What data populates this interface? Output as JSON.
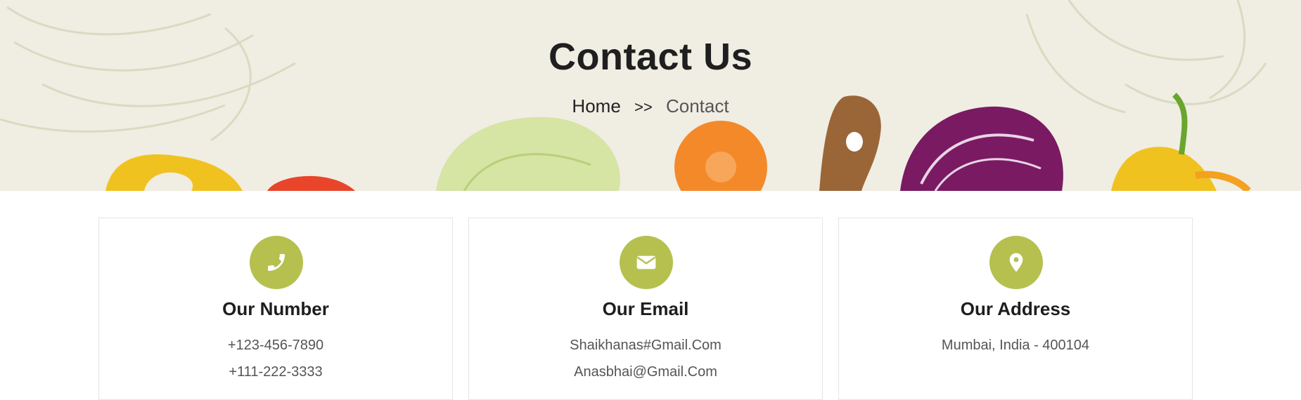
{
  "hero": {
    "title": "Contact Us",
    "breadcrumb": {
      "home": "Home",
      "separator": ">>",
      "current": "Contact"
    }
  },
  "cards": [
    {
      "title": "Our Number",
      "icon": "phone-icon",
      "lines": [
        "+123-456-7890",
        "+111-222-3333"
      ]
    },
    {
      "title": "Our Email",
      "icon": "envelope-icon",
      "lines": [
        "Shaikhanas#Gmail.Com",
        "Anasbhai@Gmail.Com"
      ]
    },
    {
      "title": "Our Address",
      "icon": "map-pin-icon",
      "lines": [
        "Mumbai, India - 400104"
      ]
    }
  ],
  "colors": {
    "accent": "#b5c04f",
    "hero_bg": "#f0ede3",
    "heading": "#1f1f1f",
    "body_text": "#555555"
  }
}
